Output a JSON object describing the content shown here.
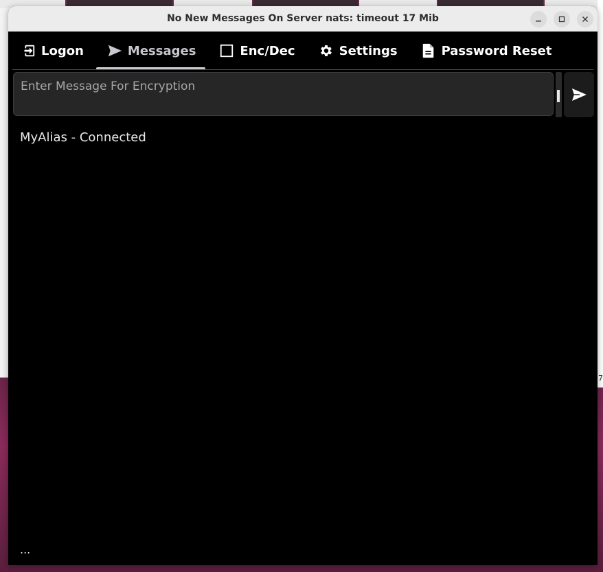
{
  "window": {
    "title": "No New Messages On Server nats: timeout 17 Mib"
  },
  "tabs": [
    {
      "label": "Logon",
      "icon": "logon-icon"
    },
    {
      "label": "Messages",
      "icon": "send-icon"
    },
    {
      "label": "Enc/Dec",
      "icon": "checkbox-icon"
    },
    {
      "label": "Settings",
      "icon": "gear-icon"
    },
    {
      "label": "Password Reset",
      "icon": "document-icon"
    }
  ],
  "compose": {
    "placeholder": "Enter Message For Encryption",
    "value": ""
  },
  "status": {
    "text": "MyAlias - Connected"
  },
  "footer": {
    "text": "..."
  },
  "background": {
    "side_label": "7"
  },
  "colors": {
    "window_bg": "#000000",
    "titlebar_bg": "#ececec",
    "compose_bg": "#262626",
    "active_tab_indicator": "#c9c9cf",
    "desktop_accent": "#8a2b5b"
  }
}
